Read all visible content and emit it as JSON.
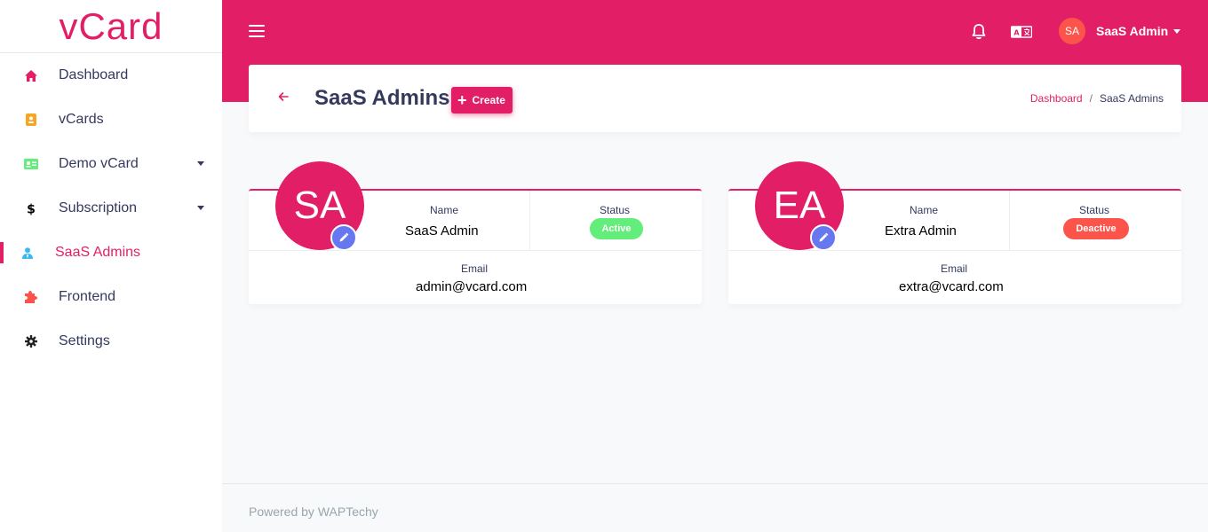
{
  "brand": {
    "name": "vCard"
  },
  "sidebar": {
    "items": [
      {
        "label": "Dashboard",
        "icon": "home-icon"
      },
      {
        "label": "vCards",
        "icon": "id-badge-icon"
      },
      {
        "label": "Demo vCard",
        "icon": "id-card-icon"
      },
      {
        "label": "Subscription",
        "icon": "dollar-icon"
      },
      {
        "label": "SaaS Admins",
        "icon": "user-tie-icon"
      },
      {
        "label": "Frontend",
        "icon": "puzzle-icon"
      },
      {
        "label": "Settings",
        "icon": "gear-icon"
      }
    ]
  },
  "topbar": {
    "user_initials": "SA",
    "user_name": "SaaS Admin"
  },
  "page_header": {
    "title": "SaaS Admins",
    "create_label": "Create",
    "breadcrumb": [
      "Dashboard",
      "SaaS Admins"
    ]
  },
  "labels": {
    "name": "Name",
    "status": "Status",
    "email": "Email"
  },
  "admins": [
    {
      "initials": "SA",
      "name": "SaaS Admin",
      "status": "Active",
      "email": "admin@vcard.com"
    },
    {
      "initials": "EA",
      "name": "Extra Admin",
      "status": "Deactive",
      "email": "extra@vcard.com"
    }
  ],
  "footer": {
    "text": "Powered by WAPTechy"
  },
  "colors": {
    "primary": "#e21f66",
    "active": "#63ed7a",
    "deactive": "#fc544b",
    "edit": "#6777ef"
  }
}
